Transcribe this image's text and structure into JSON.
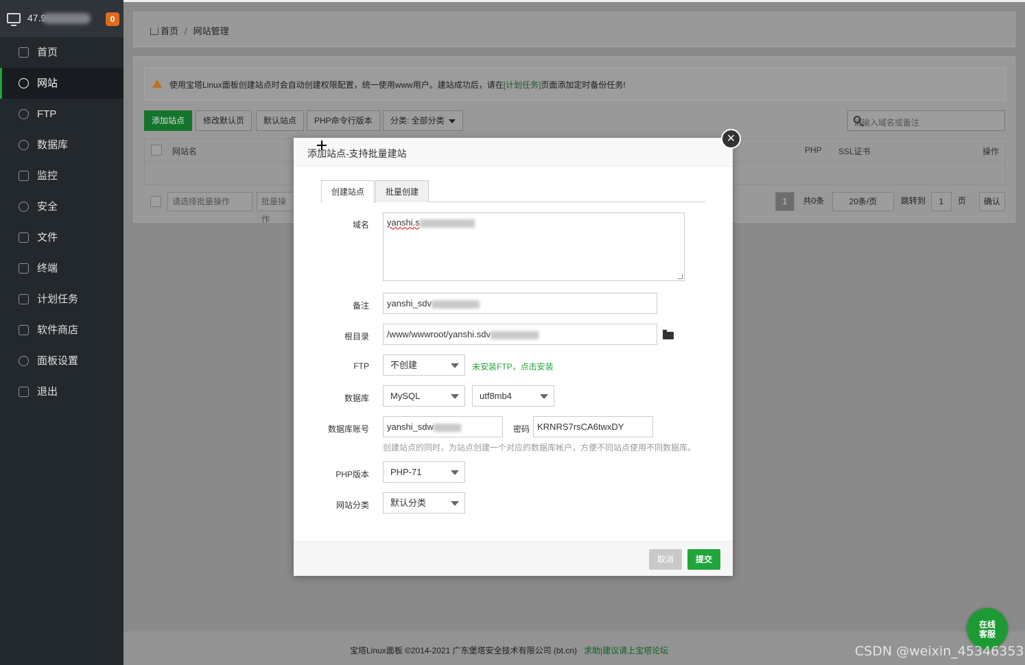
{
  "sidebar": {
    "server_ip": "47.9",
    "alert_count": "0",
    "items": [
      {
        "label": "首页",
        "icon": "home-icon"
      },
      {
        "label": "网站",
        "icon": "globe-icon",
        "active": true
      },
      {
        "label": "FTP",
        "icon": "ftp-icon"
      },
      {
        "label": "数据库",
        "icon": "database-icon"
      },
      {
        "label": "监控",
        "icon": "monitor-icon"
      },
      {
        "label": "安全",
        "icon": "shield-icon"
      },
      {
        "label": "文件",
        "icon": "folder-icon"
      },
      {
        "label": "终端",
        "icon": "terminal-icon"
      },
      {
        "label": "计划任务",
        "icon": "calendar-icon"
      },
      {
        "label": "软件商店",
        "icon": "grid-icon"
      },
      {
        "label": "面板设置",
        "icon": "gear-icon"
      },
      {
        "label": "退出",
        "icon": "logout-icon"
      }
    ]
  },
  "breadcrumb": {
    "home": "首页",
    "sep": "/",
    "current": "网站管理"
  },
  "notice": {
    "pre": "使用宝塔Linux面板创建站点时会自动创建权限配置，统一使用www用户。建站成功后，请在",
    "link": "[计划任务]",
    "post": "页面添加定时备份任务!"
  },
  "toolbar": {
    "add_site": "添加站点",
    "modify_default": "修改默认页",
    "default_site": "默认站点",
    "php_cli": "PHP命令行版本",
    "category": "分类: 全部分类",
    "search_placeholder": "请输入域名或备注"
  },
  "table": {
    "col_name": "网站名",
    "col_php": "PHP",
    "col_ssl": "SSL证书",
    "col_ops": "操作"
  },
  "batch": {
    "select_placeholder": "请选择批量操作",
    "button": "批量操作"
  },
  "pager": {
    "current": "1",
    "total": "共0条",
    "per_page": "20条/页",
    "jump_label": "跳转到",
    "jump_value": "1",
    "page_unit": "页",
    "confirm": "确认"
  },
  "modal": {
    "title": "添加站点-支持批量建站",
    "tabs": [
      "创建站点",
      "批量创建"
    ],
    "domain_label": "域名",
    "domain_value": "yanshi.s",
    "remark_label": "备注",
    "remark_value": "yanshi_sdv",
    "root_label": "根目录",
    "root_value": "/www/wwwroot/yanshi.sdv",
    "ftp_label": "FTP",
    "ftp_value": "不创建",
    "ftp_hint": "未安装FTP，点击安装",
    "db_label": "数据库",
    "db_value": "MySQL",
    "db_charset": "utf8mb4",
    "db_user_label": "数据库账号",
    "db_user_value": "yanshi_sdw",
    "db_pass_label": "密码",
    "db_pass_value": "KRNRS7rsCA6twxDY",
    "db_hint": "创建站点的同时，为站点创建一个对应的数据库帐户，方便不同站点使用不同数据库。",
    "php_label": "PHP版本",
    "php_value": "PHP-71",
    "category_label": "网站分类",
    "category_value": "默认分类",
    "cancel": "取消",
    "submit": "提交"
  },
  "footer": {
    "copyright": "宝塔Linux面板 ©2014-2021 广东堡塔安全技术有限公司 (bt.cn)",
    "link": "求助|建议请上宝塔论坛"
  },
  "service": {
    "line1": "在线",
    "line2": "客服"
  },
  "watermark": "CSDN @weixin_45346353",
  "colors": {
    "accent": "#20a53a",
    "sidebar": "#23282d",
    "badge": "#e06a1a"
  }
}
